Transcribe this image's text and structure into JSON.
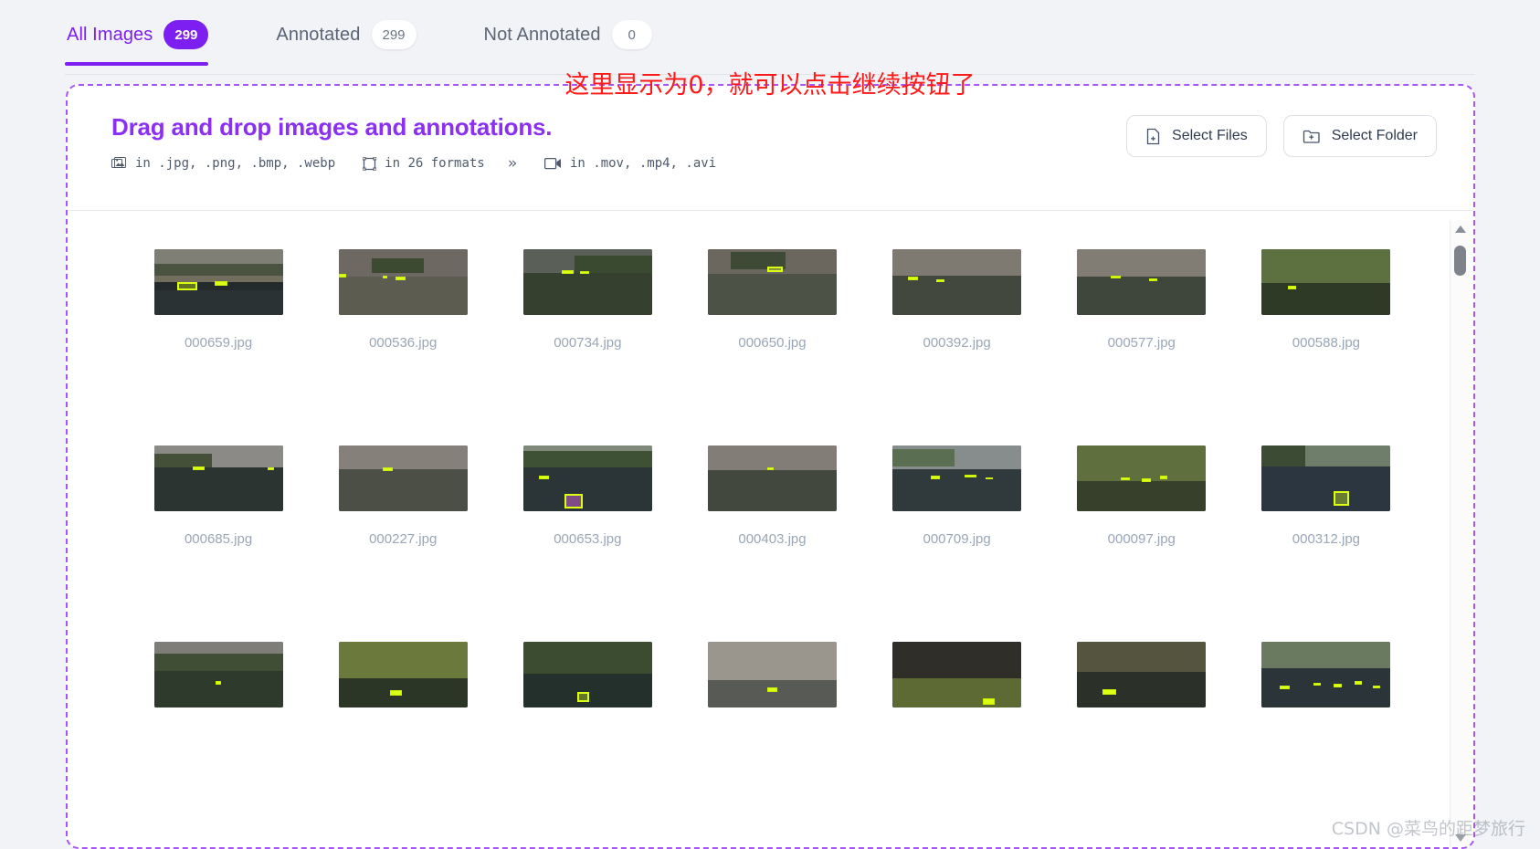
{
  "tabs": [
    {
      "label": "All Images",
      "count": "299",
      "active": true,
      "badge_style": "primary"
    },
    {
      "label": "Annotated",
      "count": "299",
      "active": false,
      "badge_style": "plain"
    },
    {
      "label": "Not Annotated",
      "count": "0",
      "active": false,
      "badge_style": "plain"
    }
  ],
  "annotation": {
    "red_note": "这里显示为0，就可以点击继续按钮了"
  },
  "dropzone": {
    "title": "Drag and drop images and annotations.",
    "formats": [
      {
        "icon": "images-icon",
        "text": "in .jpg, .png, .bmp, .webp"
      },
      {
        "icon": "bounding-box-icon",
        "text": "in 26 formats"
      },
      {
        "icon": "video-icon",
        "text": "in .mov, .mp4, .avi"
      }
    ],
    "chevron": "»",
    "buttons": [
      {
        "icon": "file-plus-icon",
        "label": "Select Files"
      },
      {
        "icon": "folder-plus-icon",
        "label": "Select Folder"
      }
    ]
  },
  "grid": {
    "rows": [
      {
        "cells": [
          {
            "filename": "000659.jpg"
          },
          {
            "filename": "000536.jpg"
          },
          {
            "filename": "000734.jpg"
          },
          {
            "filename": "000650.jpg"
          },
          {
            "filename": "000392.jpg"
          },
          {
            "filename": "000577.jpg"
          },
          {
            "filename": "000588.jpg"
          }
        ]
      },
      {
        "cells": [
          {
            "filename": "000685.jpg"
          },
          {
            "filename": "000227.jpg"
          },
          {
            "filename": "000653.jpg"
          },
          {
            "filename": "000403.jpg"
          },
          {
            "filename": "000709.jpg"
          },
          {
            "filename": "000097.jpg"
          },
          {
            "filename": "000312.jpg"
          }
        ]
      },
      {
        "cells": [
          {
            "filename": ""
          },
          {
            "filename": ""
          },
          {
            "filename": ""
          },
          {
            "filename": ""
          },
          {
            "filename": ""
          },
          {
            "filename": ""
          },
          {
            "filename": ""
          }
        ]
      }
    ]
  },
  "watermark": "CSDN @菜鸟的距梦旅行",
  "colors": {
    "accent": "#7c1ff0",
    "title": "#8b2ff5",
    "dashed_border": "#a855f7",
    "red_note": "#ff1a1a",
    "page_bg": "#f1f3f6",
    "annotation_box": "#dcff14"
  }
}
